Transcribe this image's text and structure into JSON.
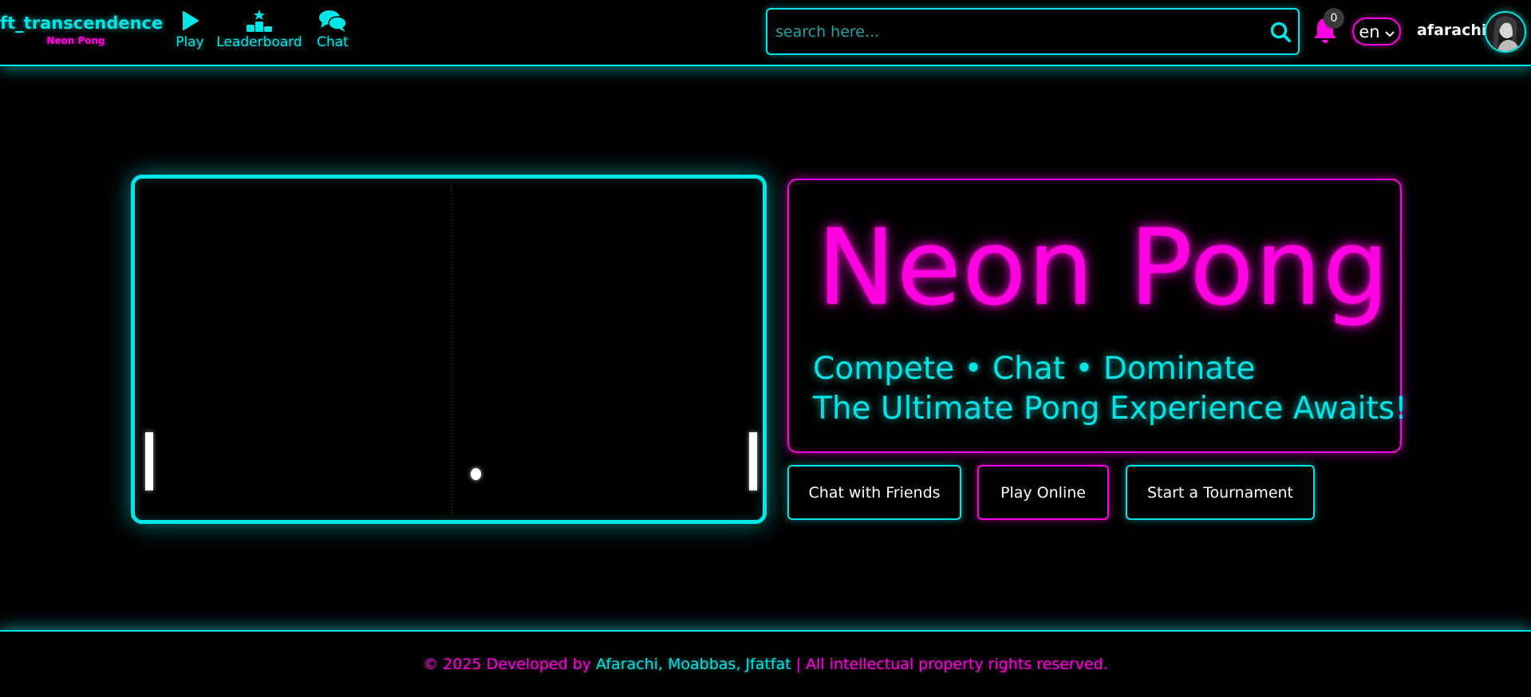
{
  "brand": {
    "title": "ft_transcendence",
    "subtitle": "Neon Pong"
  },
  "nav": {
    "items": [
      {
        "label": "Play",
        "icon": "play-icon"
      },
      {
        "label": "Leaderboard",
        "icon": "podium-icon"
      },
      {
        "label": "Chat",
        "icon": "chat-bubbles-icon"
      }
    ]
  },
  "search": {
    "placeholder": "search here...",
    "value": ""
  },
  "notifications": {
    "count": "0",
    "icon": "bell-icon"
  },
  "language": {
    "selected": "en"
  },
  "user": {
    "name": "afarachi"
  },
  "hero": {
    "title": "Neon Pong",
    "tagline": "Compete • Chat • Dominate",
    "subtitle": "The Ultimate Pong Experience Awaits!"
  },
  "actions": {
    "chat": "Chat with Friends",
    "play": "Play Online",
    "tournament": "Start a Tournament"
  },
  "game": {
    "score_left": null,
    "score_right": null
  },
  "footer": {
    "prefix": "© 2025 Developed by",
    "names": "Afarachi, Moabbas, Jfatfat",
    "suffix": "| All intellectual property rights reserved."
  },
  "colors": {
    "cyan": "#00e5e5",
    "magenta": "#ff00e0",
    "background": "#000000"
  }
}
